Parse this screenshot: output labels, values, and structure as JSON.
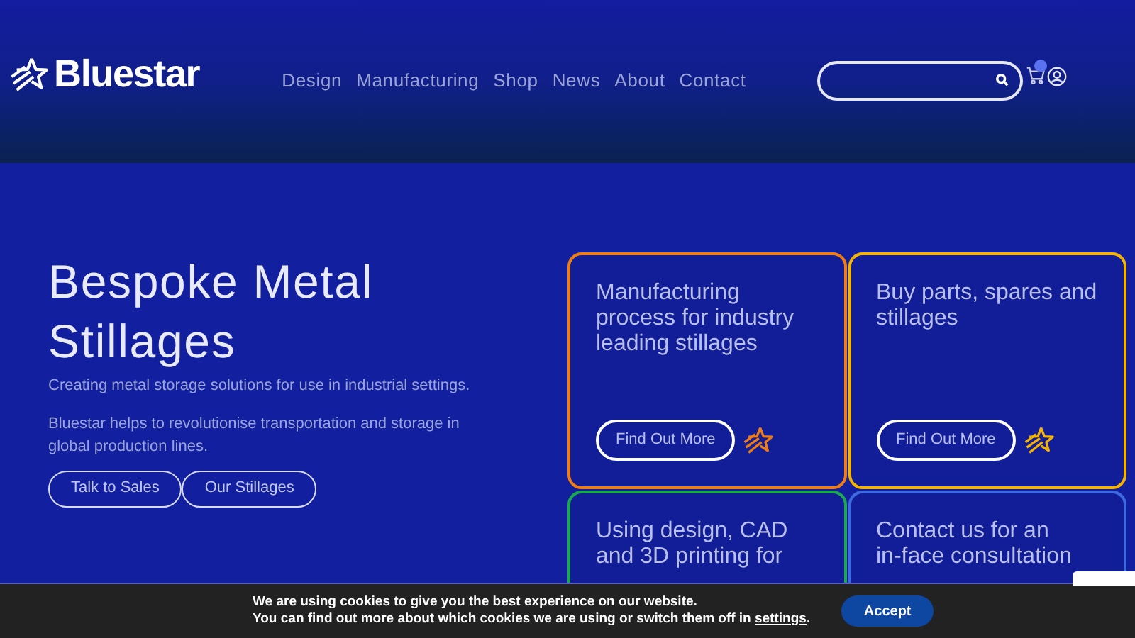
{
  "header": {
    "logo": "Bluestar",
    "nav": [
      "Design",
      "Manufacturing",
      "Shop",
      "News",
      "About",
      "Contact"
    ]
  },
  "hero": {
    "title": "Bespoke Metal Stillages",
    "subtitle": "Creating metal storage solutions for use in industrial settings.",
    "body": "Bluestar helps to revolutionise transportation and storage in global production lines.",
    "buttons": [
      "Talk to Sales",
      "Our Stillages"
    ]
  },
  "cards": [
    {
      "title_lines": [
        "Manufacturing",
        "process for industry",
        "leading stillages"
      ],
      "button": "Find Out More",
      "color": "#f07d12"
    },
    {
      "title_lines": [
        "Buy parts, spares and",
        "stillages"
      ],
      "button": "Find Out More",
      "color": "#f5b400"
    },
    {
      "title_lines": [
        "Using design, CAD",
        "and 3D printing for"
      ],
      "color": "#1aa850"
    },
    {
      "title_lines": [
        "Contact us for an",
        "in-face consultation"
      ],
      "color": "#3d6ae0"
    }
  ],
  "cookie_bar": {
    "line_1": "We are using cookies to give you the best experience on our website.",
    "line_2": "You can find out more about which cookies we are using or switch them off in",
    "link": "settings",
    "line_end": ".",
    "button": "Accept"
  }
}
